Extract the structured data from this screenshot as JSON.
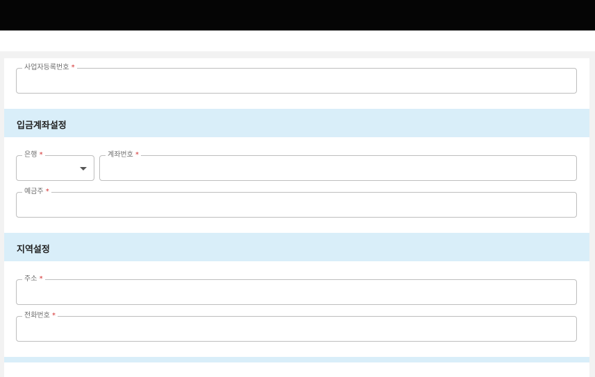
{
  "fields": {
    "business_number": {
      "label": "사업자등록번호",
      "required": "*",
      "value": ""
    },
    "bank": {
      "label": "은행",
      "required": "*",
      "value": ""
    },
    "account_number": {
      "label": "계좌번호",
      "required": "*",
      "value": ""
    },
    "account_holder": {
      "label": "예금주",
      "required": "*",
      "value": ""
    },
    "address": {
      "label": "주소",
      "required": "*",
      "value": ""
    },
    "phone": {
      "label": "전화번호",
      "required": "*",
      "value": ""
    }
  },
  "sections": {
    "deposit_account": "입금계좌설정",
    "region": "지역설정"
  },
  "icons": {
    "bank_dropdown": "chevron-down-icon"
  },
  "colors": {
    "topbar": "#050505",
    "section_header_bg": "#d9eef9",
    "required_star": "#d32f2f",
    "field_border": "#bdbdbd"
  }
}
